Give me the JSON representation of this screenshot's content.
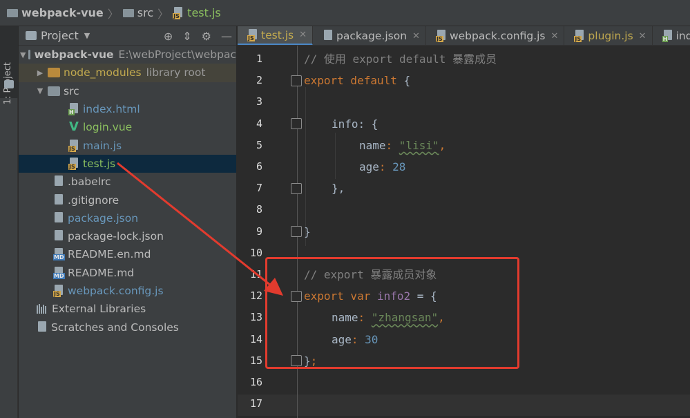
{
  "breadcrumb": {
    "project": "webpack-vue",
    "folder": "src",
    "file": "test.js"
  },
  "toolstrip": {
    "project_label": "1: Project"
  },
  "panel": {
    "title": "Project"
  },
  "tree": {
    "root_name": "webpack-vue",
    "root_path": "E:\\webProject\\webpac",
    "node_modules": "node_modules",
    "node_modules_note": "library root",
    "src": "src",
    "index_html": "index.html",
    "login_vue": "login.vue",
    "main_js": "main.js",
    "test_js": "test.js",
    "babelrc": ".babelrc",
    "gitignore": ".gitignore",
    "package_json": "package.json",
    "package_lock": "package-lock.json",
    "readme_en": "README.en.md",
    "readme": "README.md",
    "webpack_config": "webpack.config.js",
    "external_libs": "External Libraries",
    "scratches": "Scratches and Consoles"
  },
  "tabs": [
    {
      "label": "test.js"
    },
    {
      "label": "package.json"
    },
    {
      "label": "webpack.config.js"
    },
    {
      "label": "plugin.js"
    },
    {
      "label": "index."
    }
  ],
  "editor": {
    "line_numbers": [
      "1",
      "2",
      "3",
      "4",
      "5",
      "6",
      "7",
      "8",
      "9",
      "10",
      "11",
      "12",
      "13",
      "14",
      "15",
      "16",
      "17"
    ],
    "l1": "// 使用 export default 暴露成员",
    "l2_kw": "export default",
    "l2_brace": " {",
    "l4_prop": "info",
    "l4_rest": ": {",
    "l5_prop": "name",
    "l5_colon": ": ",
    "l5_str": "\"lisi\"",
    "l5_comma": ",",
    "l6_prop": "age",
    "l6_colon": ": ",
    "l6_num": "28",
    "l7": "},",
    "l9": "}",
    "l11": "// export 暴露成员对象",
    "l12_kw": "export var",
    "l12_var": " info2",
    "l12_rest": " = {",
    "l13_prop": "name",
    "l13_colon": ": ",
    "l13_str": "\"zhangsan\"",
    "l13_comma": ",",
    "l14_prop": "age",
    "l14_colon": ": ",
    "l14_num": "30",
    "l15_brace": "}",
    "l15_semi": ";"
  },
  "colors": {
    "keyword": "#cc7832",
    "comment": "#808080",
    "property": "#9876aa",
    "string": "#6a8759",
    "number": "#6897bb",
    "annotation": "#e23b2e"
  }
}
